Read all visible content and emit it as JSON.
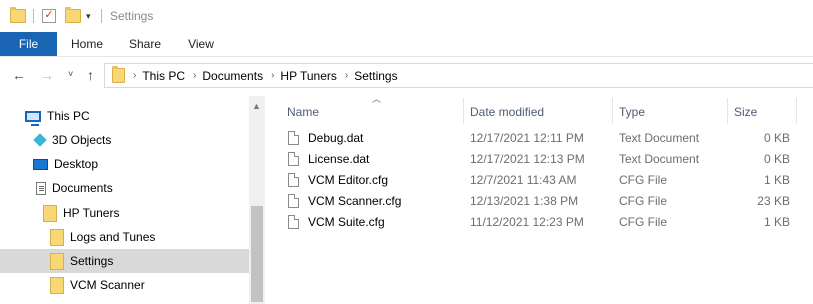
{
  "window": {
    "title": "Settings"
  },
  "ribbon": {
    "tabs": [
      "File",
      "Home",
      "Share",
      "View"
    ]
  },
  "address": {
    "crumbs": [
      "This PC",
      "Documents",
      "HP Tuners",
      "Settings"
    ]
  },
  "nav_pane": {
    "items": [
      {
        "label": "This PC",
        "icon": "pc-icon"
      },
      {
        "label": "3D Objects",
        "icon": "3d-objects-icon"
      },
      {
        "label": "Desktop",
        "icon": "desktop-icon"
      },
      {
        "label": "Documents",
        "icon": "documents-icon"
      },
      {
        "label": "HP Tuners",
        "icon": "folder-icon"
      },
      {
        "label": "Logs and Tunes",
        "icon": "folder-icon"
      },
      {
        "label": "Settings",
        "icon": "folder-icon",
        "selected": true
      },
      {
        "label": "VCM Scanner",
        "icon": "folder-icon"
      }
    ]
  },
  "columns": [
    "Name",
    "Date modified",
    "Type",
    "Size"
  ],
  "files": [
    {
      "name": "Debug.dat",
      "date": "12/17/2021 12:11 PM",
      "type": "Text Document",
      "size": "0 KB"
    },
    {
      "name": "License.dat",
      "date": "12/17/2021 12:13 PM",
      "type": "Text Document",
      "size": "0 KB"
    },
    {
      "name": "VCM Editor.cfg",
      "date": "12/7/2021 11:43 AM",
      "type": "CFG File",
      "size": "1 KB"
    },
    {
      "name": "VCM Scanner.cfg",
      "date": "12/13/2021 1:38 PM",
      "type": "CFG File",
      "size": "23 KB"
    },
    {
      "name": "VCM Suite.cfg",
      "date": "11/12/2021 12:23 PM",
      "type": "CFG File",
      "size": "1 KB"
    }
  ],
  "colors": {
    "file_tab": "#1a64b4",
    "selection": "#d9d9d9",
    "header_text": "#4d5b74"
  }
}
